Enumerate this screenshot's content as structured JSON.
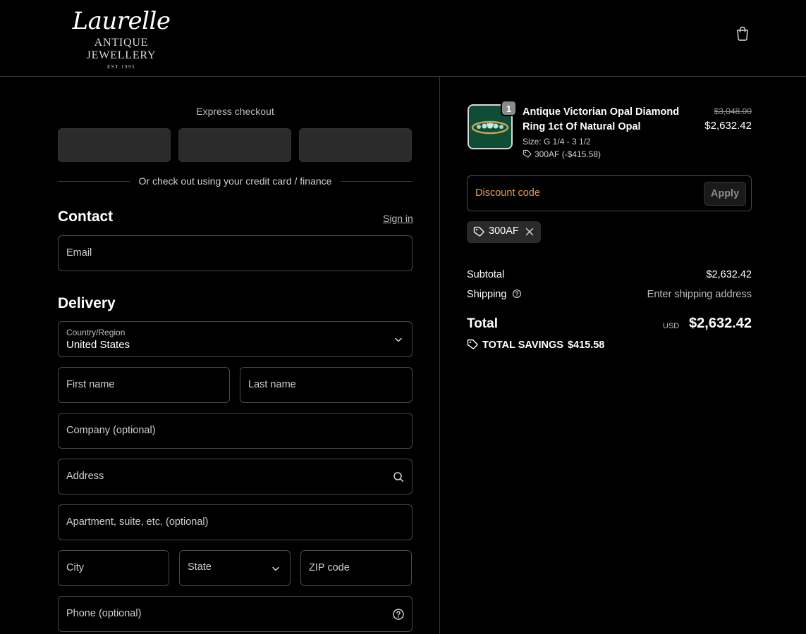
{
  "brand": {
    "script": "Laurelle",
    "subtitle": "ANTIQUE JEWELLERY",
    "est": "EST 1995"
  },
  "icons": {
    "cart": "shopping-bag-icon",
    "search": "search-icon",
    "help": "question-circle-icon",
    "chevron": "chevron-down-icon",
    "tag": "tag-icon",
    "close": "close-icon"
  },
  "express": {
    "label": "Express checkout",
    "divider_text": "Or check out using your credit card / finance"
  },
  "contact": {
    "title": "Contact",
    "sign_in": "Sign in",
    "email_placeholder": "Email"
  },
  "delivery": {
    "title": "Delivery",
    "country_label": "Country/Region",
    "country_value": "United States",
    "first_name": "First name",
    "last_name": "Last name",
    "company": "Company (optional)",
    "address": "Address",
    "apartment": "Apartment, suite, etc. (optional)",
    "city": "City",
    "state": "State",
    "zip": "ZIP code",
    "phone": "Phone (optional)"
  },
  "order": {
    "item": {
      "quantity": "1",
      "name": "Antique Victorian Opal Diamond Ring 1ct Of Natural Opal",
      "size": "Size: G 1/4 - 3 1/2",
      "discount": "300AF (-$415.58)",
      "price_original": "$3,048.00",
      "price_final": "$2,632.42"
    },
    "discount_placeholder": "Discount code",
    "apply_label": "Apply",
    "applied_code": "300AF",
    "subtotal_label": "Subtotal",
    "subtotal_value": "$2,632.42",
    "shipping_label": "Shipping",
    "shipping_value": "Enter shipping address",
    "total_label": "Total",
    "currency": "USD",
    "total_value": "$2,632.42",
    "savings_label": "TOTAL SAVINGS",
    "savings_value": "$415.58"
  },
  "colors": {
    "background": "#000000",
    "border": "#4a4a4a",
    "discount_placeholder": "#e09a55",
    "express_button": "#2b2b2b"
  }
}
